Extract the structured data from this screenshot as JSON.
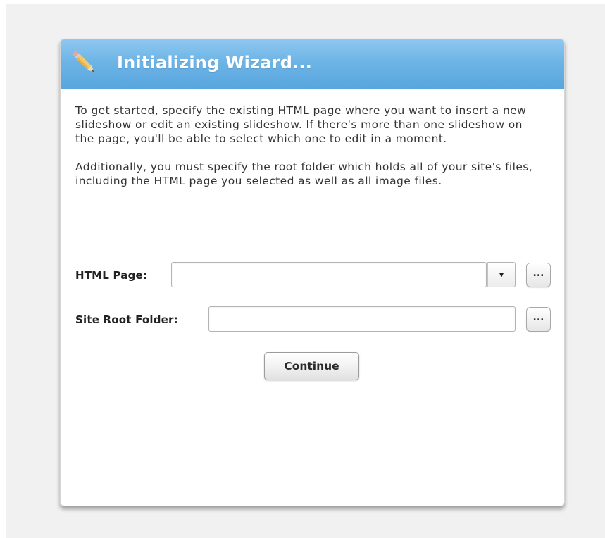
{
  "dialog": {
    "title": "Initializing Wizard...",
    "icon": "pencil-icon",
    "paragraphs": [
      "To get started, specify the existing HTML page where you want to insert a new slideshow or edit an existing slideshow.  If there's more than one slideshow on the page, you'll be able to select which one to edit in a moment.",
      "Additionally, you must specify the root folder which holds all of your site's files, including the HTML page you selected as well as all image files."
    ]
  },
  "form": {
    "html_page": {
      "label": "HTML Page:",
      "value": "",
      "dropdown_arrow": "▾",
      "browse_label": "..."
    },
    "site_root": {
      "label": "Site Root Folder:",
      "value": "",
      "browse_label": "..."
    },
    "continue_label": "Continue"
  },
  "colors": {
    "header_top": "#8ec8ef",
    "header_bottom": "#58a6de",
    "title_text": "#ffffff",
    "body_text": "#333333"
  }
}
